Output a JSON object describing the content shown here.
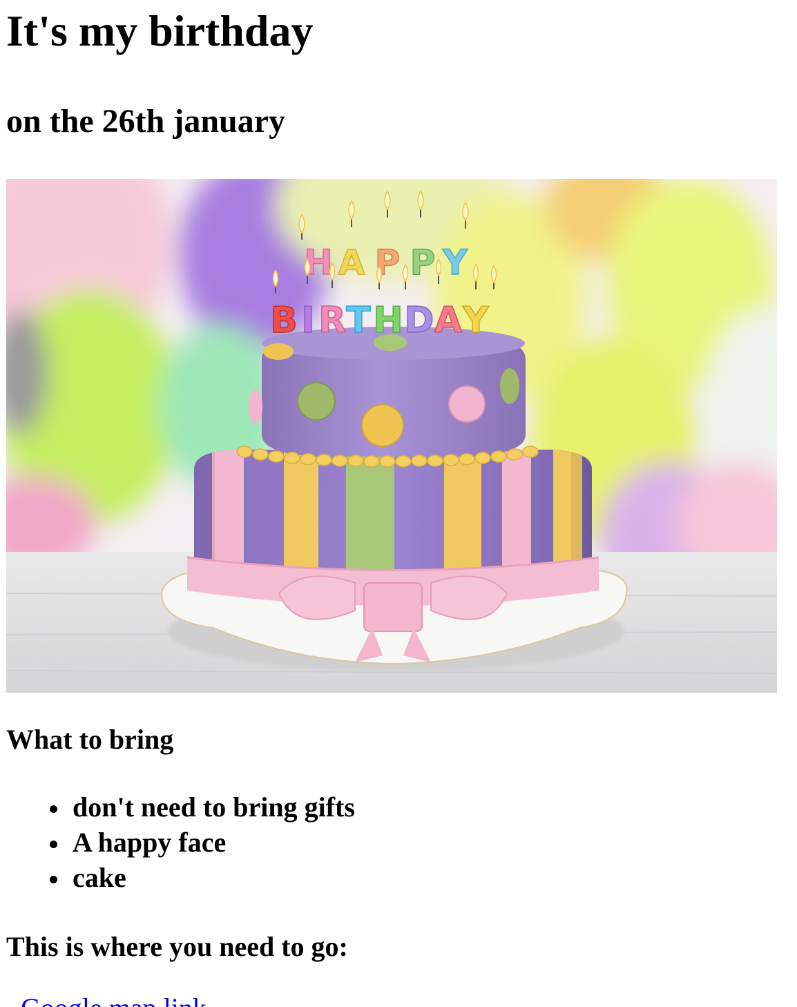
{
  "page": {
    "title": "It's my birthday",
    "subtitle": "on the 26th january"
  },
  "hero_image": {
    "alt": "Birthday cake with candles spelling HAPPY BIRTHDAY in front of colorful balloons",
    "candle_letters_top": [
      "H",
      "A",
      "P",
      "P",
      "Y"
    ],
    "candle_letters_bottom": [
      "B",
      "I",
      "R",
      "T",
      "H",
      "D",
      "A",
      "Y"
    ]
  },
  "bring": {
    "heading": "What to bring",
    "items": [
      "don't need to bring gifts",
      "A happy face",
      "cake"
    ]
  },
  "directions": {
    "heading": "This is where you need to go:",
    "link_text": "Google map link"
  },
  "colors": {
    "link": "#0000ee",
    "cake_purple": "#9b84c8",
    "ribbon_pink": "#f2b8cf",
    "stripe_yellow": "#f0c860",
    "stripe_green": "#a8c878"
  }
}
